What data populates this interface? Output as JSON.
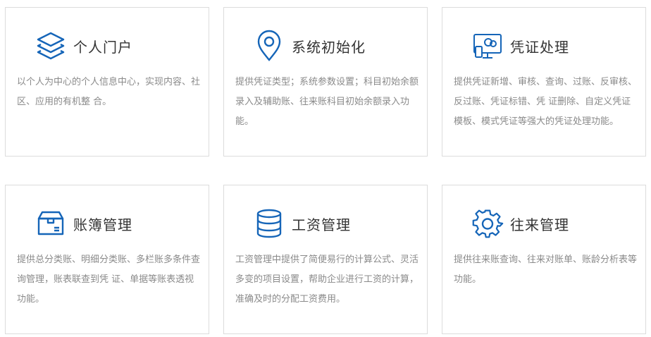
{
  "accent_color": "#1565b8",
  "cards": [
    {
      "icon": "layers-icon",
      "title": "个人门户",
      "description": "以个人为中心的个人信息中心，实现内容、社区、应用的有机整 合。"
    },
    {
      "icon": "location-pin-icon",
      "title": "系统初始化",
      "description": "提供凭证类型；系统参数设置；科目初始余额录入及辅助账、往来账科目初始余额录入功能。"
    },
    {
      "icon": "monitor-chat-icon",
      "title": "凭证处理",
      "description": "提供凭证新增、审核、查询、过账、反审核、反过账、凭证标错、凭 证删除、自定义凭证模板、模式凭证等强大的凭证处理功能。"
    },
    {
      "icon": "package-box-icon",
      "title": "账簿管理",
      "description": "提供总分类账、明细分类账、多栏账多条件查询管理，账表联查到凭 证、单据等账表透视功能。"
    },
    {
      "icon": "database-icon",
      "title": "工资管理",
      "description": "工资管理中提供了简便易行的计算公式、灵活多变的项目设置，帮助企业进行工资的计算，准确及时的分配工资费用。"
    },
    {
      "icon": "gear-icon",
      "title": "往来管理",
      "description": "提供往来账查询、往来对账单、账龄分析表等功能。"
    }
  ]
}
